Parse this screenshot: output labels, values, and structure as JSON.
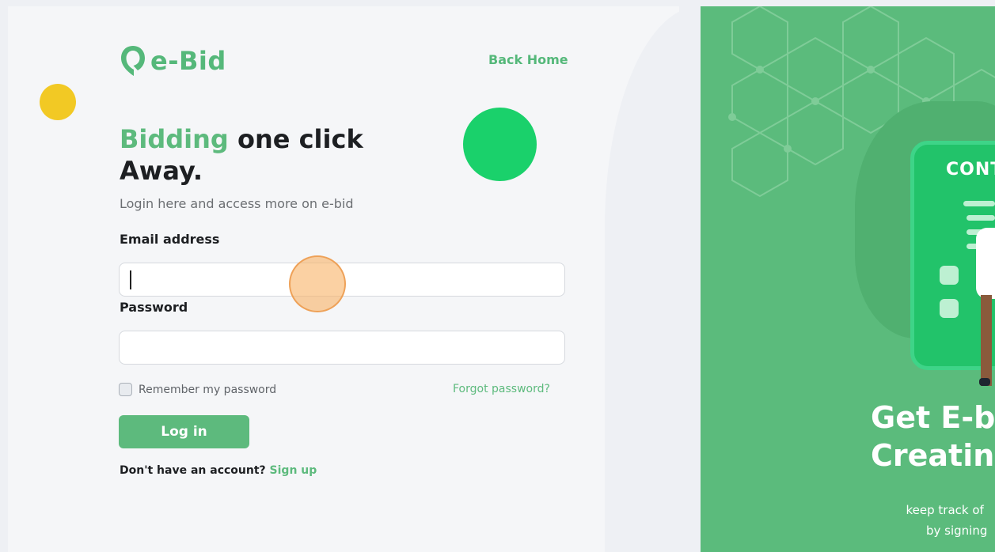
{
  "brand": {
    "name": "e-Bid",
    "color": "#55b87a",
    "icon": "map-pin-logo-icon"
  },
  "nav": {
    "back_home": "Back Home"
  },
  "hero": {
    "headline_accent": "Bidding",
    "headline_rest": " one click",
    "headline_line2": "Away.",
    "subtitle": "Login here and access more on e-bid"
  },
  "form": {
    "email_label": "Email address",
    "email_value": "",
    "email_placeholder": "",
    "password_label": "Password",
    "password_value": "",
    "password_placeholder": "",
    "remember_label": "Remember my password",
    "remember_checked": false,
    "forgot_label": "Forgot password?",
    "login_label": "Log in",
    "signup_prompt": "Don't have an account?",
    "signup_link": "Sign up"
  },
  "promo": {
    "card_title": "CONT",
    "title_line1": "Get E-b",
    "title_line2": "Creatin",
    "sub_line1": "keep track of",
    "sub_line2": "by signing"
  },
  "colors": {
    "accent": "#5dba7d",
    "right_panel": "#5bbb7c",
    "yellow_dot": "#f2c924",
    "green_dot": "#1ad16b",
    "cursor_highlight": "#f9b365"
  }
}
